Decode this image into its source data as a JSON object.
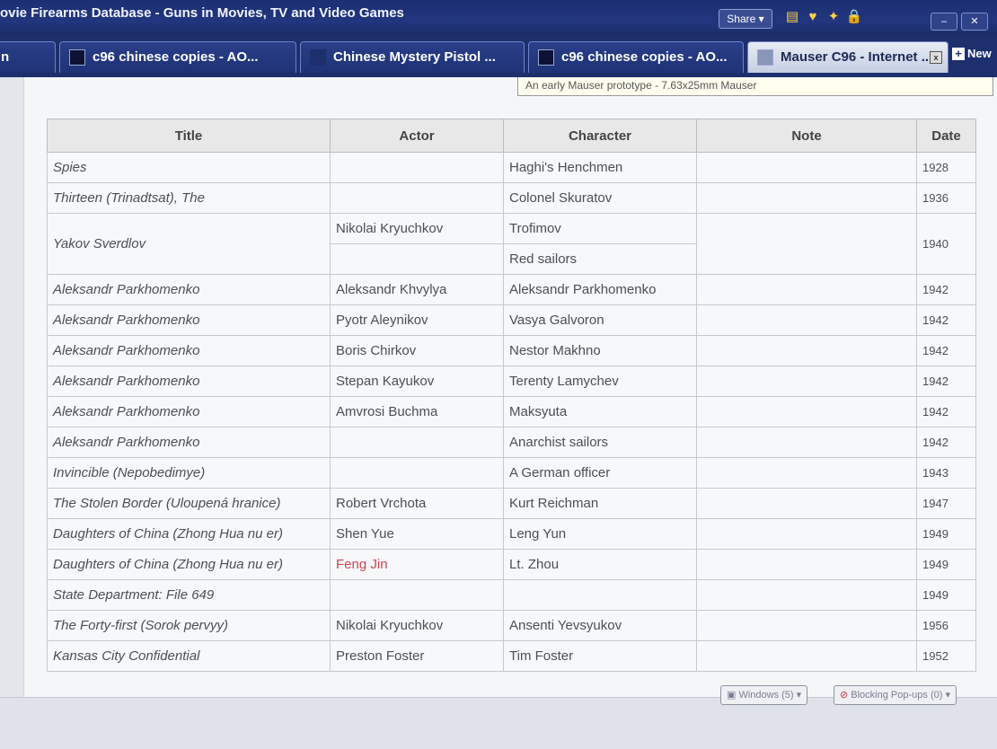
{
  "window": {
    "title": "ovie Firearms Database - Guns in Movies, TV and Video Games",
    "share_label": "Share ▾"
  },
  "tabs": [
    {
      "label": "n"
    },
    {
      "label": "c96 chinese copies - AO..."
    },
    {
      "label": "Chinese Mystery Pistol ..."
    },
    {
      "label": "c96 chinese copies - AO..."
    },
    {
      "label": "Mauser C96 - Internet ..."
    }
  ],
  "new_tab_label": "New",
  "tooltip_text": "An early Mauser prototype - 7.63x25mm Mauser",
  "table": {
    "headers": [
      "Title",
      "Actor",
      "Character",
      "Note",
      "Date"
    ],
    "rows": [
      {
        "title": "Spies",
        "actor": "",
        "character": "Haghi's Henchmen",
        "note": "",
        "date": "1928"
      },
      {
        "title": "Thirteen (Trinadtsat), The",
        "actor": "",
        "character": "Colonel Skuratov",
        "note": "",
        "date": "1936"
      },
      {
        "title": "Yakov Sverdlov",
        "actor": "Nikolai Kryuchkov",
        "character": "Trofimov",
        "note": "",
        "date": "1940"
      },
      {
        "actor": "",
        "character": "Red sailors"
      },
      {
        "title": "Aleksandr Parkhomenko",
        "actor": "Aleksandr Khvylya",
        "character": "Aleksandr Parkhomenko",
        "note": "",
        "date": "1942"
      },
      {
        "title": "Aleksandr Parkhomenko",
        "actor": "Pyotr Aleynikov",
        "character": "Vasya Galvoron",
        "note": "",
        "date": "1942"
      },
      {
        "title": "Aleksandr Parkhomenko",
        "actor": "Boris Chirkov",
        "character": "Nestor Makhno",
        "note": "",
        "date": "1942"
      },
      {
        "title": "Aleksandr Parkhomenko",
        "actor": "Stepan Kayukov",
        "character": "Terenty Lamychev",
        "note": "",
        "date": "1942"
      },
      {
        "title": "Aleksandr Parkhomenko",
        "actor": "Amvrosi Buchma",
        "character": "Maksyuta",
        "note": "",
        "date": "1942"
      },
      {
        "title": "Aleksandr Parkhomenko",
        "actor": "",
        "character": "Anarchist sailors",
        "note": "",
        "date": "1942"
      },
      {
        "title": "Invincible (Nepobedimye)",
        "actor": "",
        "character": "A German officer",
        "note": "",
        "date": "1943"
      },
      {
        "title": "The Stolen Border (Uloupená hranice)",
        "actor": "Robert Vrchota",
        "character": "Kurt Reichman",
        "note": "",
        "date": "1947"
      },
      {
        "title": "Daughters of China (Zhong Hua nu er)",
        "actor": "Shen Yue",
        "character": "Leng Yun",
        "note": "",
        "date": "1949"
      },
      {
        "title": "Daughters of China (Zhong Hua nu er)",
        "actor": "Feng Jin",
        "character": "Lt. Zhou",
        "note": "",
        "date": "1949"
      },
      {
        "title": "State Department: File 649",
        "actor": "",
        "character": "",
        "note": "",
        "date": "1949"
      },
      {
        "title": "The Forty-first (Sorok pervyy)",
        "actor": "Nikolai Kryuchkov",
        "character": "Ansenti Yevsyukov",
        "note": "",
        "date": "1956"
      },
      {
        "title": "Kansas City Confidential",
        "actor": "Preston Foster",
        "character": "Tim Foster",
        "note": "",
        "date": "1952"
      }
    ]
  },
  "statusbar": {
    "windows_label": "Windows (5) ▾",
    "popups_label": "Blocking Pop-ups (0) ▾"
  }
}
